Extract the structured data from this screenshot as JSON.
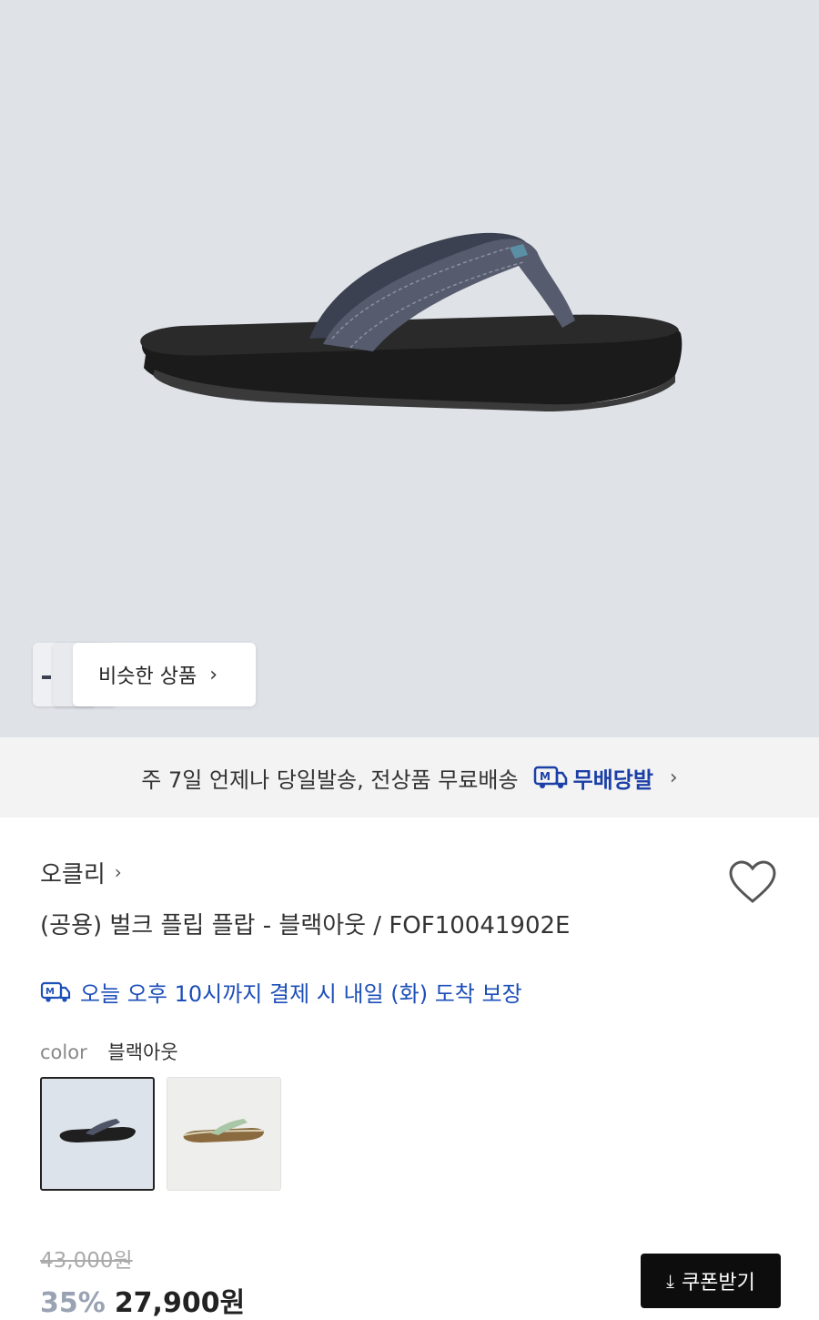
{
  "hero": {
    "similar_label": "비슷한 상품",
    "background": "#dfe3e8"
  },
  "banner": {
    "text": "주 7일 언제나 당일발송, 전상품 무료배송",
    "brand": "무배당발",
    "brand_color": "#1b3fa6"
  },
  "product": {
    "brand": "오클리",
    "title": "(공용) 벌크 플립 플랍 - 블랙아웃 / FOF10041902E",
    "delivery_notice": "오늘 오후 10시까지 결제 시 내일 (화) 도착 보장",
    "color_label": "color",
    "color_value": "블랙아웃",
    "original_price": "43,000원",
    "discount": "35%",
    "price": "27,900원"
  },
  "actions": {
    "coupon_label": "쿠폰받기"
  }
}
